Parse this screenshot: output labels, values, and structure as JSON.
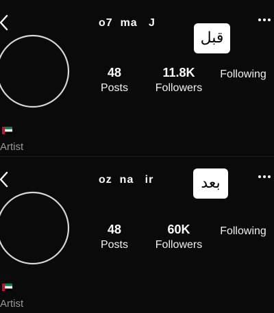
{
  "colors": {
    "background": "#000000",
    "panel": "#0a0a0a",
    "text": "#ffffff",
    "muted": "#9a9a9a",
    "tag_bg": "#ffffff",
    "tag_text": "#000000",
    "avatar_ring": "#d8d8d8",
    "flag_red": "#c8102e",
    "flag_green": "#00843d",
    "flag_white": "#ffffff",
    "flag_black": "#000000"
  },
  "icons": {
    "back": "chevron-left-icon",
    "more": "more-horizontal-icon",
    "flag": "uae-flag-icon"
  },
  "panels": [
    {
      "tag": "قبل",
      "username": "o7  ma   J",
      "stats": [
        {
          "value": "48",
          "label": "Posts"
        },
        {
          "value": "11.8K",
          "label": "Followers"
        },
        {
          "value": "",
          "label": "Following"
        }
      ],
      "role": "Artist"
    },
    {
      "tag": "بعد",
      "username": "oz  na   ir",
      "stats": [
        {
          "value": "48",
          "label": "Posts"
        },
        {
          "value": "60K",
          "label": "Followers"
        },
        {
          "value": "",
          "label": "Following"
        }
      ],
      "role": "Artist"
    }
  ]
}
